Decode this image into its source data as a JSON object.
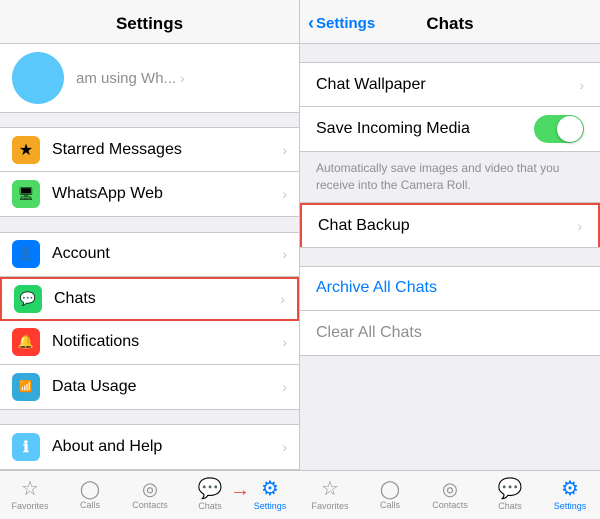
{
  "left": {
    "header": "Settings",
    "profile_status": "am using Wh...",
    "items_group1": [
      {
        "id": "starred",
        "label": "Starred Messages",
        "icon_color": "yellow",
        "icon_char": "★"
      },
      {
        "id": "whatsapp_web",
        "label": "WhatsApp Web",
        "icon_color": "green",
        "icon_char": "🖥"
      }
    ],
    "items_group2": [
      {
        "id": "account",
        "label": "Account",
        "icon_color": "blue",
        "icon_char": "👤",
        "selected": false
      },
      {
        "id": "chats",
        "label": "Chats",
        "icon_color": "chats",
        "icon_char": "💬",
        "selected": true
      },
      {
        "id": "notifications",
        "label": "Notifications",
        "icon_color": "notif",
        "icon_char": "🔔"
      },
      {
        "id": "data_usage",
        "label": "Data Usage",
        "icon_color": "data",
        "icon_char": "📶"
      }
    ],
    "items_group3": [
      {
        "id": "about_help",
        "label": "About and Help",
        "icon_color": "about",
        "icon_char": "ℹ"
      }
    ]
  },
  "right": {
    "header": "Chats",
    "back_label": "Settings",
    "items_group1": [
      {
        "id": "wallpaper",
        "label": "Chat Wallpaper",
        "has_chevron": true
      },
      {
        "id": "save_media",
        "label": "Save Incoming Media",
        "has_toggle": true,
        "toggle_on": true
      }
    ],
    "save_media_description": "Automatically save images and video that you receive into the Camera Roll.",
    "items_group2": [
      {
        "id": "chat_backup",
        "label": "Chat Backup",
        "has_chevron": true,
        "selected": true
      }
    ],
    "items_group3": [
      {
        "id": "archive_all",
        "label": "Archive All Chats",
        "is_link": true
      },
      {
        "id": "clear_all",
        "label": "Clear All Chats",
        "is_disabled": true
      }
    ]
  },
  "tabs_left": [
    {
      "id": "favorites",
      "label": "Favorites",
      "icon": "☆",
      "active": false
    },
    {
      "id": "calls",
      "label": "Calls",
      "icon": "○",
      "active": false
    },
    {
      "id": "contacts",
      "label": "Contacts",
      "icon": "◎",
      "active": false
    },
    {
      "id": "chats",
      "label": "Chats",
      "icon": "💬",
      "active": false
    },
    {
      "id": "settings",
      "label": "Settings",
      "icon": "⚙",
      "active": true
    }
  ],
  "tabs_right": [
    {
      "id": "favorites",
      "label": "Favorites",
      "icon": "☆",
      "active": false
    },
    {
      "id": "calls",
      "label": "Calls",
      "icon": "○",
      "active": false
    },
    {
      "id": "contacts",
      "label": "Contacts",
      "icon": "◎",
      "active": false
    },
    {
      "id": "chats",
      "label": "Chats",
      "icon": "💬",
      "active": false
    },
    {
      "id": "settings",
      "label": "Settings",
      "icon": "⚙",
      "active": true
    }
  ]
}
